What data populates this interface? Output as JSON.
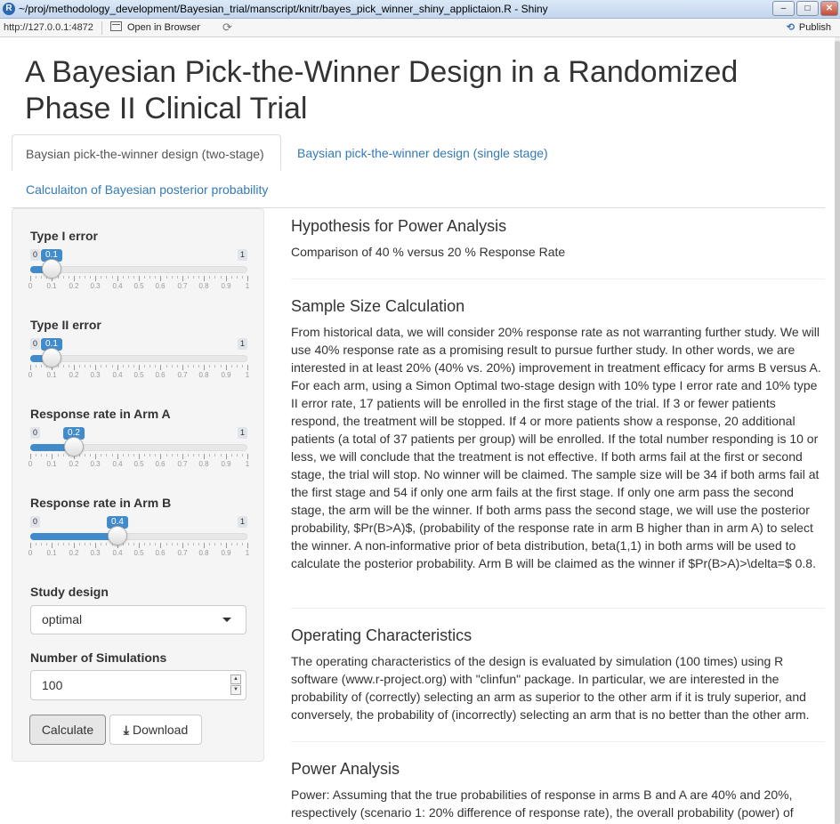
{
  "window": {
    "title": "~/proj/methodology_development/Bayesian_trial/manscript/knitr/bayes_pick_winner_shiny_applictaion.R - Shiny",
    "app_icon": "R",
    "minimize": "–",
    "maximize": "□",
    "close": "✕"
  },
  "toolbar": {
    "url": "http://127.0.0.1:4872",
    "open_in_browser": "Open in Browser",
    "refresh_icon": "⟳",
    "publish_label": "Publish",
    "publish_icon": "⟲"
  },
  "page": {
    "title": "A Bayesian Pick-the-Winner Design in a Randomized Phase II Clinical Trial"
  },
  "tabs": [
    {
      "label": "Baysian pick-the-winner design (two-stage)",
      "active": true
    },
    {
      "label": "Baysian pick-the-winner design (single stage)",
      "active": false
    },
    {
      "label": "Calculaiton of Bayesian posterior probability",
      "active": false
    }
  ],
  "sidebar": {
    "sliders": [
      {
        "label": "Type I error",
        "min": 0,
        "max": 1,
        "value": 0.1,
        "display": "0.1",
        "min_label": "0",
        "max_label": "1"
      },
      {
        "label": "Type II error",
        "min": 0,
        "max": 1,
        "value": 0.1,
        "display": "0.1",
        "min_label": "0",
        "max_label": "1"
      },
      {
        "label": "Response rate in Arm A",
        "min": 0,
        "max": 1,
        "value": 0.2,
        "display": "0.2",
        "min_label": "0",
        "max_label": "1"
      },
      {
        "label": "Response rate in Arm B",
        "min": 0,
        "max": 1,
        "value": 0.4,
        "display": "0.4",
        "min_label": "0",
        "max_label": "1"
      }
    ],
    "tick_labels": [
      "0",
      "0.1",
      "0.2",
      "0.3",
      "0.4",
      "0.5",
      "0.6",
      "0.7",
      "0.8",
      "0.9",
      "1"
    ],
    "study_design": {
      "label": "Study design",
      "value": "optimal"
    },
    "simulations": {
      "label": "Number of Simulations",
      "value": "100"
    },
    "calculate_label": "Calculate",
    "download_label": "Download",
    "download_icon": "⤓",
    "spin_up": "▲",
    "spin_down": "▼"
  },
  "main": {
    "sections": [
      {
        "heading": "Hypothesis for Power Analysis",
        "text": "Comparison of 40 % versus 20 % Response Rate"
      },
      {
        "heading": "Sample Size Calculation",
        "text": "From historical data, we will consider 20% response rate as not warranting further study. We will use 40% response rate as a promising result to pursue further study. In other words, we are interested in at least 20% (40% vs. 20%) improvement in treatment efficacy for arms B versus A. For each arm, using a Simon Optimal two-stage design with 10% type I error rate and 10% type II error rate, 17 patients will be enrolled in the first stage of the trial. If 3 or fewer patients respond, the treatment will be stopped. If 4 or more patients show a response, 20 additional patients (a total of 37 patients per group) will be enrolled. If the total number responding is 10 or less, we will conclude that the treatment is not effective. If both arms fail at the first or second stage, the trial will stop. No winner will be claimed. The sample size will be 34 if both arms fail at the first stage and 54 if only one arm fails at the first stage. If only one arm pass the second stage, the arm will be the winner. If both arms pass the second stage, we will use the posterior probability, $Pr(B>A)$, (probability of the response rate in arm B higher than in arm A) to select the winner. A non-informative prior of beta distribution, beta(1,1) in both arms will be used to calculate the posterior probability. Arm B will be claimed as the winner if $Pr(B>A)>\\delta=$ 0.8."
      },
      {
        "heading": "Operating Characteristics",
        "text": "The operating characteristics of the design is evaluated by simulation (100 times) using R software (www.r-project.org) with \"clinfun\" package. In particular, we are interested in the probability of (correctly) selecting an arm as superior to the other arm if it is truly superior, and conversely, the probability of (incorrectly) selecting an arm that is no better than the other arm."
      },
      {
        "heading": "Power Analysis",
        "text": "Power: Assuming that the true probabilities of response in arms B and A are 40% and 20%, respectively (scenario 1: 20% difference of response rate), the overall probability (power) of"
      }
    ]
  },
  "colors": {
    "accent": "#428bca",
    "link": "#337ab7",
    "text": "#333333",
    "sidebar_bg": "#f5f5f5"
  }
}
